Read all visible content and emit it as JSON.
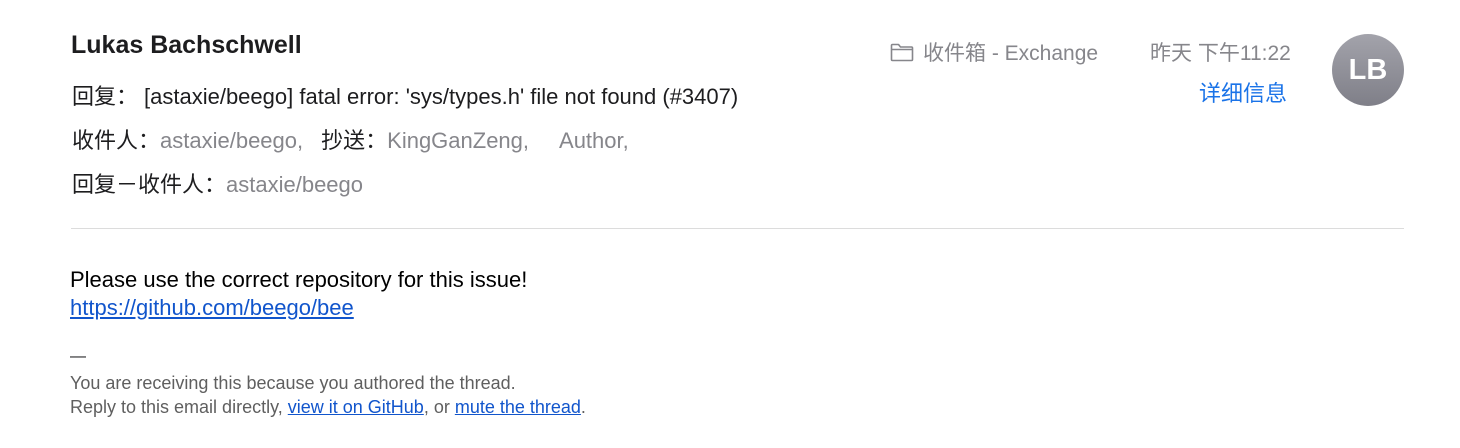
{
  "header": {
    "sender": "Lukas Bachschwell",
    "subject_label": "回复：",
    "subject": "[astaxie/beego] fatal error: 'sys/types.h' file not found (#3407)",
    "to_label": "收件人：",
    "to_value": "astaxie/beego,",
    "cc_label": "抄送：",
    "cc_values": [
      "KingGanZeng,",
      "Author,"
    ],
    "replyto_label": "回复－收件人：",
    "replyto_value": "astaxie/beego",
    "mailbox_icon": "folder-icon",
    "mailbox": "收件箱 - Exchange",
    "date": "昨天 下午11:22",
    "details_link": "详细信息",
    "avatar_initials": "LB"
  },
  "body": {
    "line1": "Please use the correct repository for this issue!",
    "repo_link": "https://github.com/beego/bee",
    "separator": "—",
    "footer_line1": "You are receiving this because you authored the thread.",
    "footer_prefix": "Reply to this email directly, ",
    "footer_link1": "view it on GitHub",
    "footer_mid": ", or ",
    "footer_link2": "mute the thread",
    "footer_suffix": "."
  },
  "colors": {
    "link_blue": "#1a73e8",
    "body_link": "#1155cc",
    "muted_gray": "#86868b",
    "avatar_bg": "#8e8e96"
  }
}
